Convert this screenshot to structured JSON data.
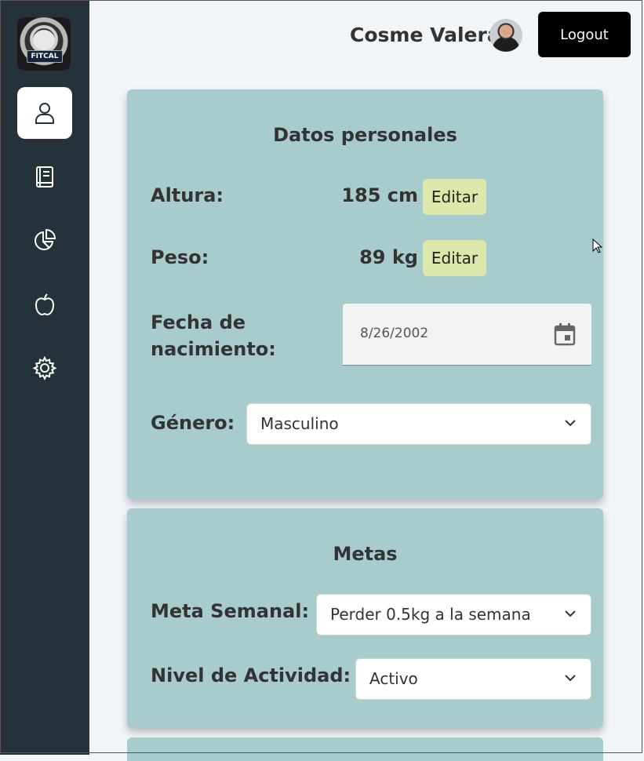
{
  "header": {
    "user_name": "Cosme Valera",
    "logout_label": "Logout"
  },
  "sidebar": {
    "logo_text": "FITCAL",
    "items": [
      {
        "icon": "user-icon",
        "active": true
      },
      {
        "icon": "book-icon",
        "active": false
      },
      {
        "icon": "pie-chart-icon",
        "active": false
      },
      {
        "icon": "apple-icon",
        "active": false
      },
      {
        "icon": "gear-icon",
        "active": false
      }
    ]
  },
  "personal": {
    "title": "Datos personales",
    "height_label": "Altura:",
    "height_value": "185 cm",
    "weight_label": "Peso:",
    "weight_value": "89 kg",
    "edit_label": "Editar",
    "birth_label_line1": "Fecha de",
    "birth_label_line2": "nacimiento:",
    "birth_value": "8/26/2002",
    "gender_label": "Género:",
    "gender_value": "Masculino"
  },
  "goals": {
    "title": "Metas",
    "weekly_label": "Meta Semanal:",
    "weekly_value": "Perder 0.5kg a la semana",
    "activity_label": "Nivel de Actividad:",
    "activity_value": "Activo"
  },
  "colors": {
    "sidebar_bg": "#263239",
    "card_bg": "#a8cbcb",
    "edit_bg": "#dce8a9",
    "page_bg": "#f2f5f8"
  }
}
